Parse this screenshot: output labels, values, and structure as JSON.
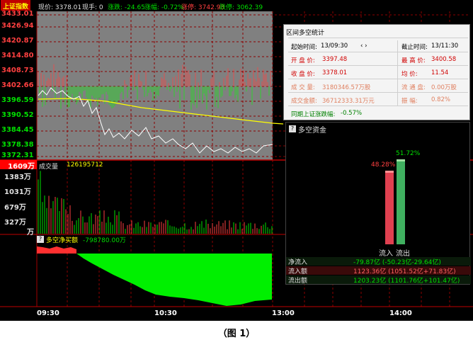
{
  "header": {
    "index_name": "上证指数",
    "price": "现价: 3378.01",
    "volume_now": "现手: 0",
    "change": "涨跌: -24.65",
    "change_pct": "涨幅: -0.72%",
    "limit_up": "涨停: 3742.93",
    "limit_down": "跌停: 3062.39"
  },
  "price_axis": [
    "3433.01",
    "3426.94",
    "3420.87",
    "3414.80",
    "3408.73",
    "3402.66",
    "3396.59",
    "3390.52",
    "3384.45",
    "3378.38",
    "3372.31"
  ],
  "volume_panel": {
    "max_label": "1609万",
    "title": "成交量",
    "value": "126195712",
    "axis": [
      "1383万",
      "1031万",
      "679万",
      "327万",
      "万"
    ]
  },
  "flow_panel": {
    "icon_text": "?",
    "title": "多空净买额",
    "value": "-798780.00万"
  },
  "time_axis": [
    "09:30",
    "10:30",
    "13:00",
    "14:00"
  ],
  "stats": {
    "title": "区间多空统计",
    "start_time_label": "起始时间:",
    "start_time": "13/09:30",
    "arrows": "‹  ›",
    "end_time_label": "截止时间:",
    "end_time": "13/11:30",
    "open_label": "开 盘 价:",
    "open": "3397.48",
    "high_label": "最 高 价:",
    "high": "3400.58",
    "close_label": "收 盘 价:",
    "close": "3378.01",
    "avg_label": "均    价:",
    "avg": "11.54",
    "vol_label": "成 交 量:",
    "vol": "3180346.57万股",
    "float_label": "流 通 盘:",
    "float": "0.00万股",
    "amount_label": "成交金额:",
    "amount": "36712333.31万元",
    "amplitude_label": "振    幅:",
    "amplitude": "0.82%",
    "same_period_label": "同期上证涨跌幅:",
    "same_period": "-0.57%"
  },
  "funds": {
    "icon_text": "?",
    "title": "多空资金",
    "inflow_pct": "48.28%",
    "outflow_pct": "51.72%",
    "inflow_ratio": 0.4828,
    "outflow_ratio": 0.5172,
    "inflow_label": "流入",
    "outflow_label": "流出",
    "net_label": "净流入",
    "net_value": "-79.87亿 (-50.23亿-29.64亿)",
    "in_label": "流入额",
    "in_value": "1123.36亿 (1051.52亿+71.83亿)",
    "out_label": "流出额",
    "out_value": "1203.23亿 (1101.76亿+101.47亿)"
  },
  "caption": "（图 1）",
  "colors": {
    "up": "#ff4040",
    "down": "#00e000",
    "grid": "#8b0000",
    "chart_bg_selected": "#808080",
    "avg_line": "#ffff00",
    "price_line": "#ffffff"
  }
}
